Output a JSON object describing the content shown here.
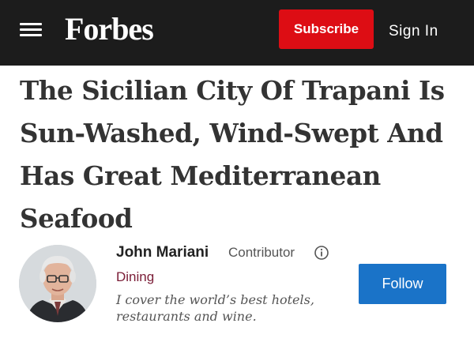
{
  "header": {
    "menu_icon": "hamburger-menu-icon",
    "logo_text": "Forbes",
    "subscribe_label": "Subscribe",
    "signin_label": "Sign In",
    "colors": {
      "bar": "#1c1c1c",
      "subscribe": "#dd0d14"
    }
  },
  "article": {
    "headline": "The Sicilian City Of Trapani Is Sun-Washed, Wind-Swept And Has Great Mediterranean Seafood"
  },
  "author": {
    "name": "John Mariani",
    "role": "Contributor",
    "info_icon": "info-circle-icon",
    "section": "Dining",
    "bio": "I cover the world’s best hotels, restaurants and wine.",
    "follow_label": "Follow",
    "colors": {
      "follow": "#1a73c8",
      "section": "#7a1c36"
    }
  }
}
